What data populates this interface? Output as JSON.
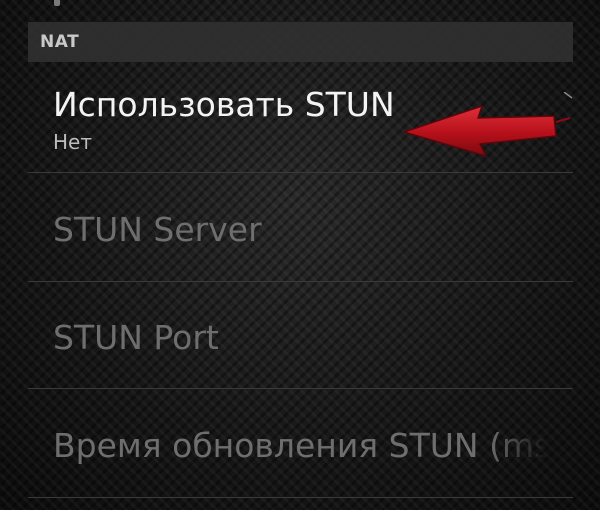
{
  "section": {
    "title": "NAT"
  },
  "preferences": [
    {
      "title": "Использовать STUN",
      "summary": "Нет",
      "enabled": true
    },
    {
      "title": "STUN Server",
      "enabled": false
    },
    {
      "title": "STUN Port",
      "enabled": false
    },
    {
      "title": "Время обновления STUN (ms)",
      "enabled": false
    }
  ],
  "annotation": {
    "arrow_color": "#c4141e",
    "icon": "red-arrow-pointer"
  }
}
